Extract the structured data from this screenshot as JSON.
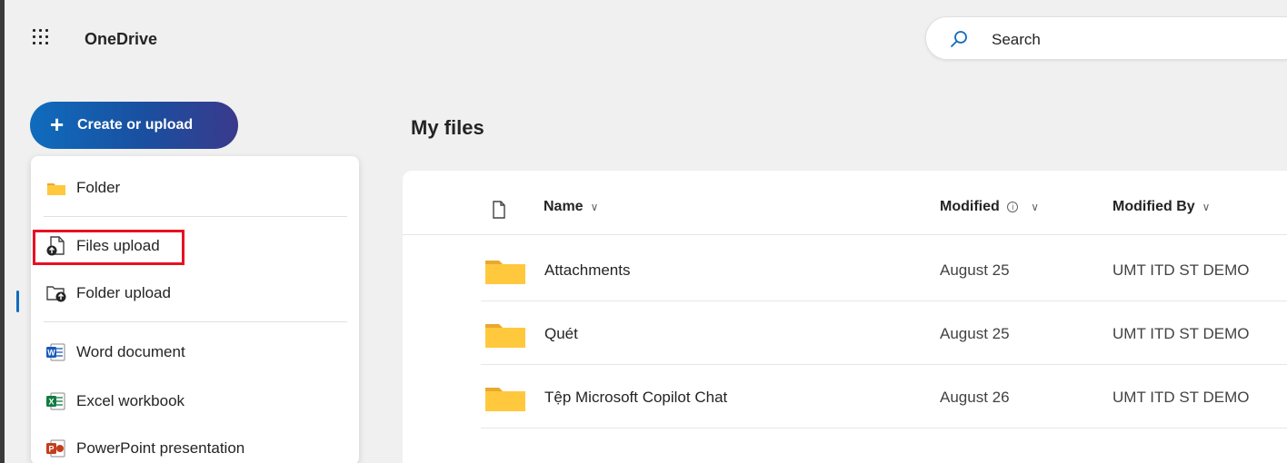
{
  "header": {
    "app_name": "OneDrive",
    "search_placeholder": "Search"
  },
  "create_button": {
    "label": "Create or upload"
  },
  "create_menu": {
    "items": [
      {
        "label": "Folder",
        "icon": "folder-icon"
      },
      {
        "label": "Files upload",
        "icon": "file-upload-icon",
        "highlighted": true
      },
      {
        "label": "Folder upload",
        "icon": "folder-upload-icon"
      },
      {
        "label": "Word document",
        "icon": "word-icon"
      },
      {
        "label": "Excel workbook",
        "icon": "excel-icon"
      },
      {
        "label": "PowerPoint presentation",
        "icon": "powerpoint-icon"
      }
    ]
  },
  "main": {
    "title": "My files",
    "columns": {
      "name": "Name",
      "modified": "Modified",
      "modified_by": "Modified By"
    },
    "rows": [
      {
        "name": "Attachments",
        "modified": "August 25",
        "modified_by": "UMT ITD ST DEMO"
      },
      {
        "name": "Quét",
        "modified": "August 25",
        "modified_by": "UMT ITD ST DEMO"
      },
      {
        "name": "Tệp Microsoft Copilot Chat",
        "modified": "August 26",
        "modified_by": "UMT ITD ST DEMO"
      }
    ]
  },
  "colors": {
    "accent": "#0f6cbd",
    "highlight_border": "#e81123",
    "folder_yellow": "#ffc83d"
  }
}
